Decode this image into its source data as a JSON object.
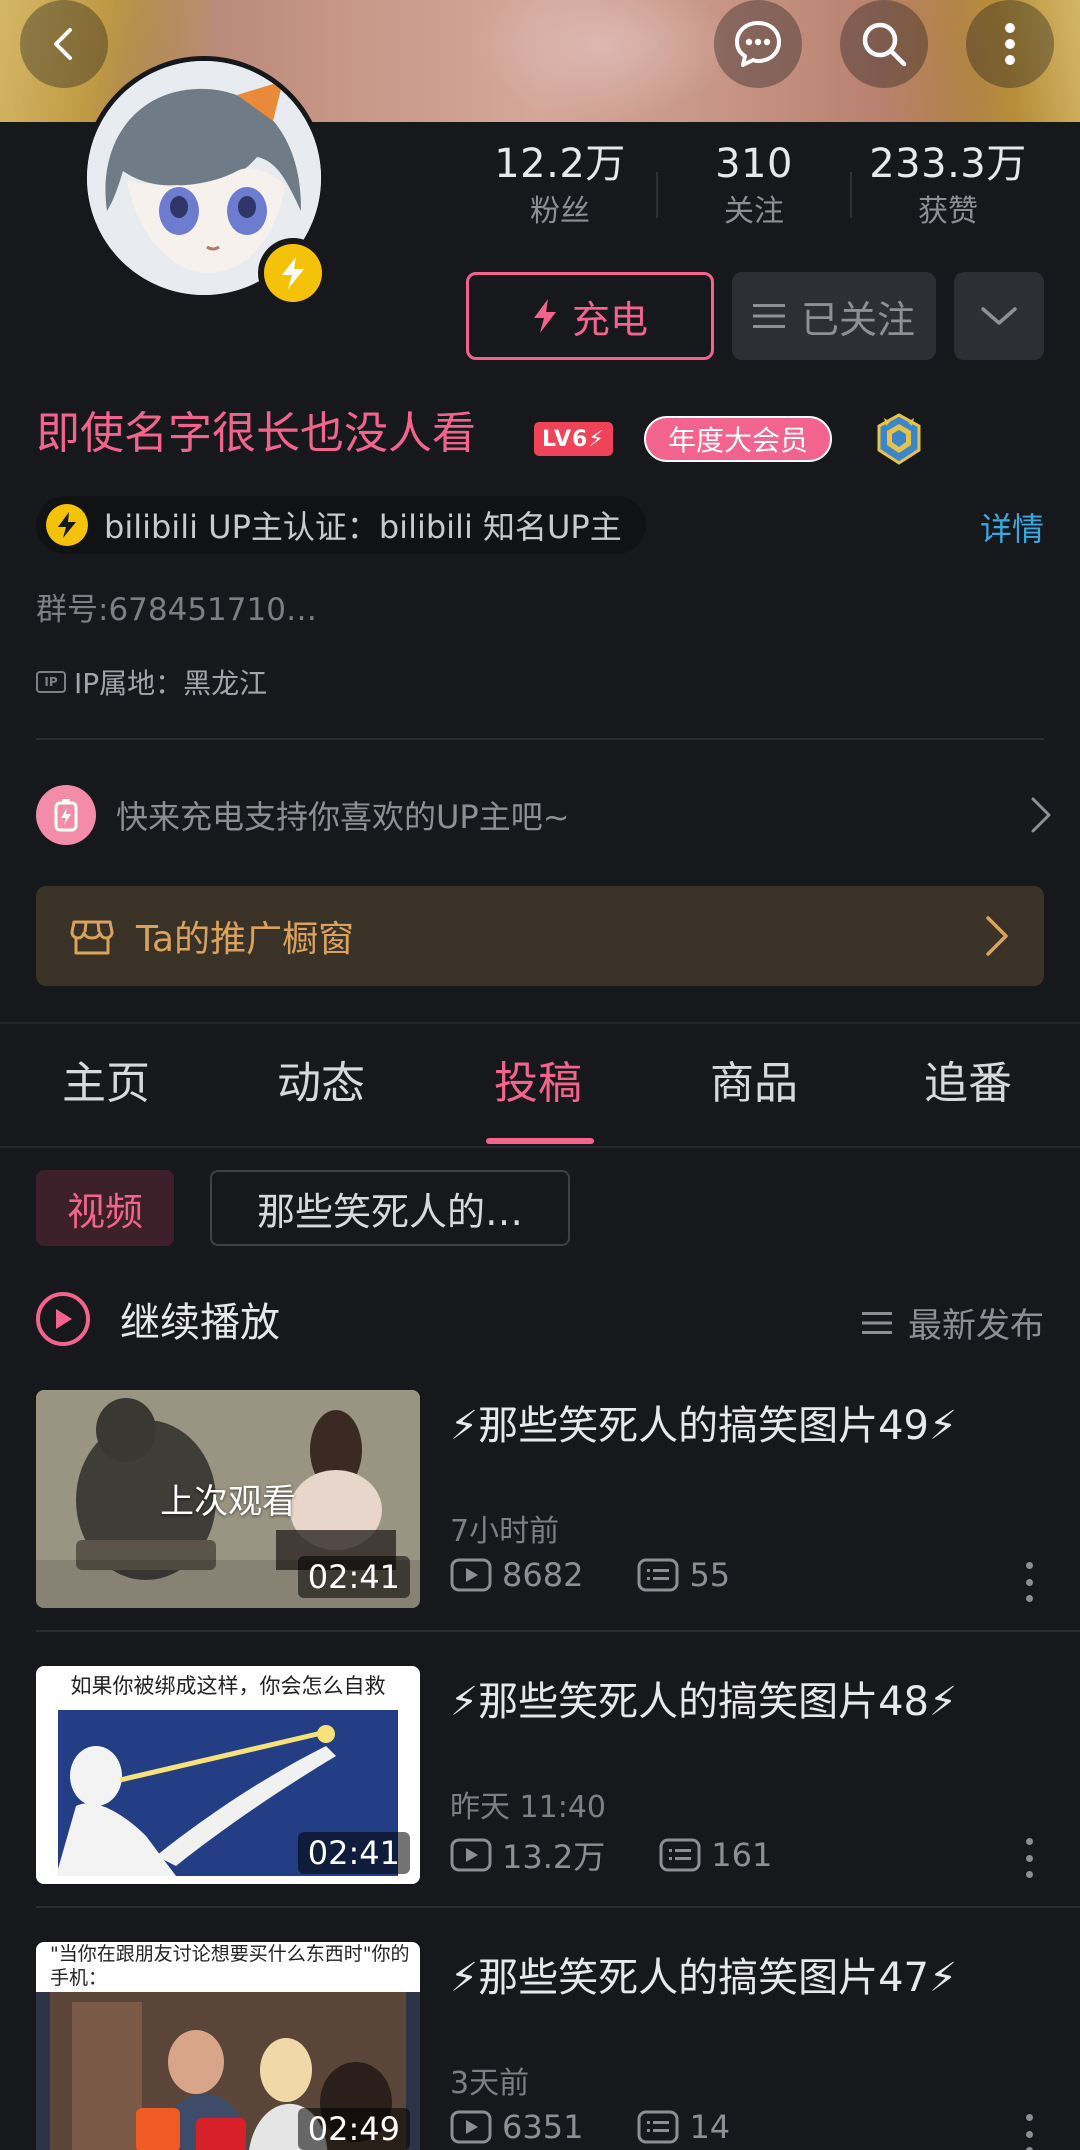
{
  "stats": {
    "fans_value": "12.2万",
    "fans_label": "粉丝",
    "following_value": "310",
    "following_label": "关注",
    "likes_value": "233.3万",
    "likes_label": "获赞"
  },
  "actions": {
    "charge_label": "充电",
    "followed_label": "已关注"
  },
  "profile": {
    "name": "即使名字很长也没人看",
    "level": "LV6⚡",
    "vip_label": "年度大会员",
    "verification": "bilibili UP主认证：bilibili 知名UP主",
    "detail_link": "详情",
    "group_number": "群号:678451710…",
    "ip_location": "IP属地：黑龙江",
    "ip_icon_text": "IP"
  },
  "promo": {
    "charge_prompt": "快来充电支持你喜欢的UP主吧~",
    "showcase": "Ta的推广橱窗"
  },
  "tabs": [
    {
      "label": "主页"
    },
    {
      "label": "动态"
    },
    {
      "label": "投稿"
    },
    {
      "label": "商品"
    },
    {
      "label": "追番"
    }
  ],
  "active_tab": 2,
  "filters": {
    "video_chip": "视频",
    "series_chip": "那些笑死人的…"
  },
  "playback": {
    "continue_label": "继续播放",
    "sort_label": "最新发布"
  },
  "videos": [
    {
      "title": "⚡那些笑死人的搞笑图片49⚡",
      "time": "7小时前",
      "views": "8682",
      "comments": "55",
      "duration": "02:41",
      "overlay": "上次观看"
    },
    {
      "title": "⚡那些笑死人的搞笑图片48⚡",
      "time": "昨天 11:40",
      "views": "13.2万",
      "comments": "161",
      "duration": "02:41",
      "thumb_caption": "如果你被绑成这样，你会怎么自救"
    },
    {
      "title": "⚡那些笑死人的搞笑图片47⚡",
      "time": "3天前",
      "views": "6351",
      "comments": "14",
      "duration": "02:49",
      "thumb_caption": "\"当你在跟朋友讨论想要买什么东西时\"你的手机："
    }
  ],
  "icons": {
    "back": "back-icon",
    "message": "message-icon",
    "search": "search-icon",
    "more": "more-vertical-icon",
    "bolt": "lightning-icon",
    "menu": "list-icon",
    "chevron": "chevron-down-icon"
  },
  "colors": {
    "accent": "#f2648e",
    "background": "#17181b",
    "gold": "#f5c20a",
    "link": "#3aa8e0",
    "showcase_text": "#d9a25e"
  }
}
